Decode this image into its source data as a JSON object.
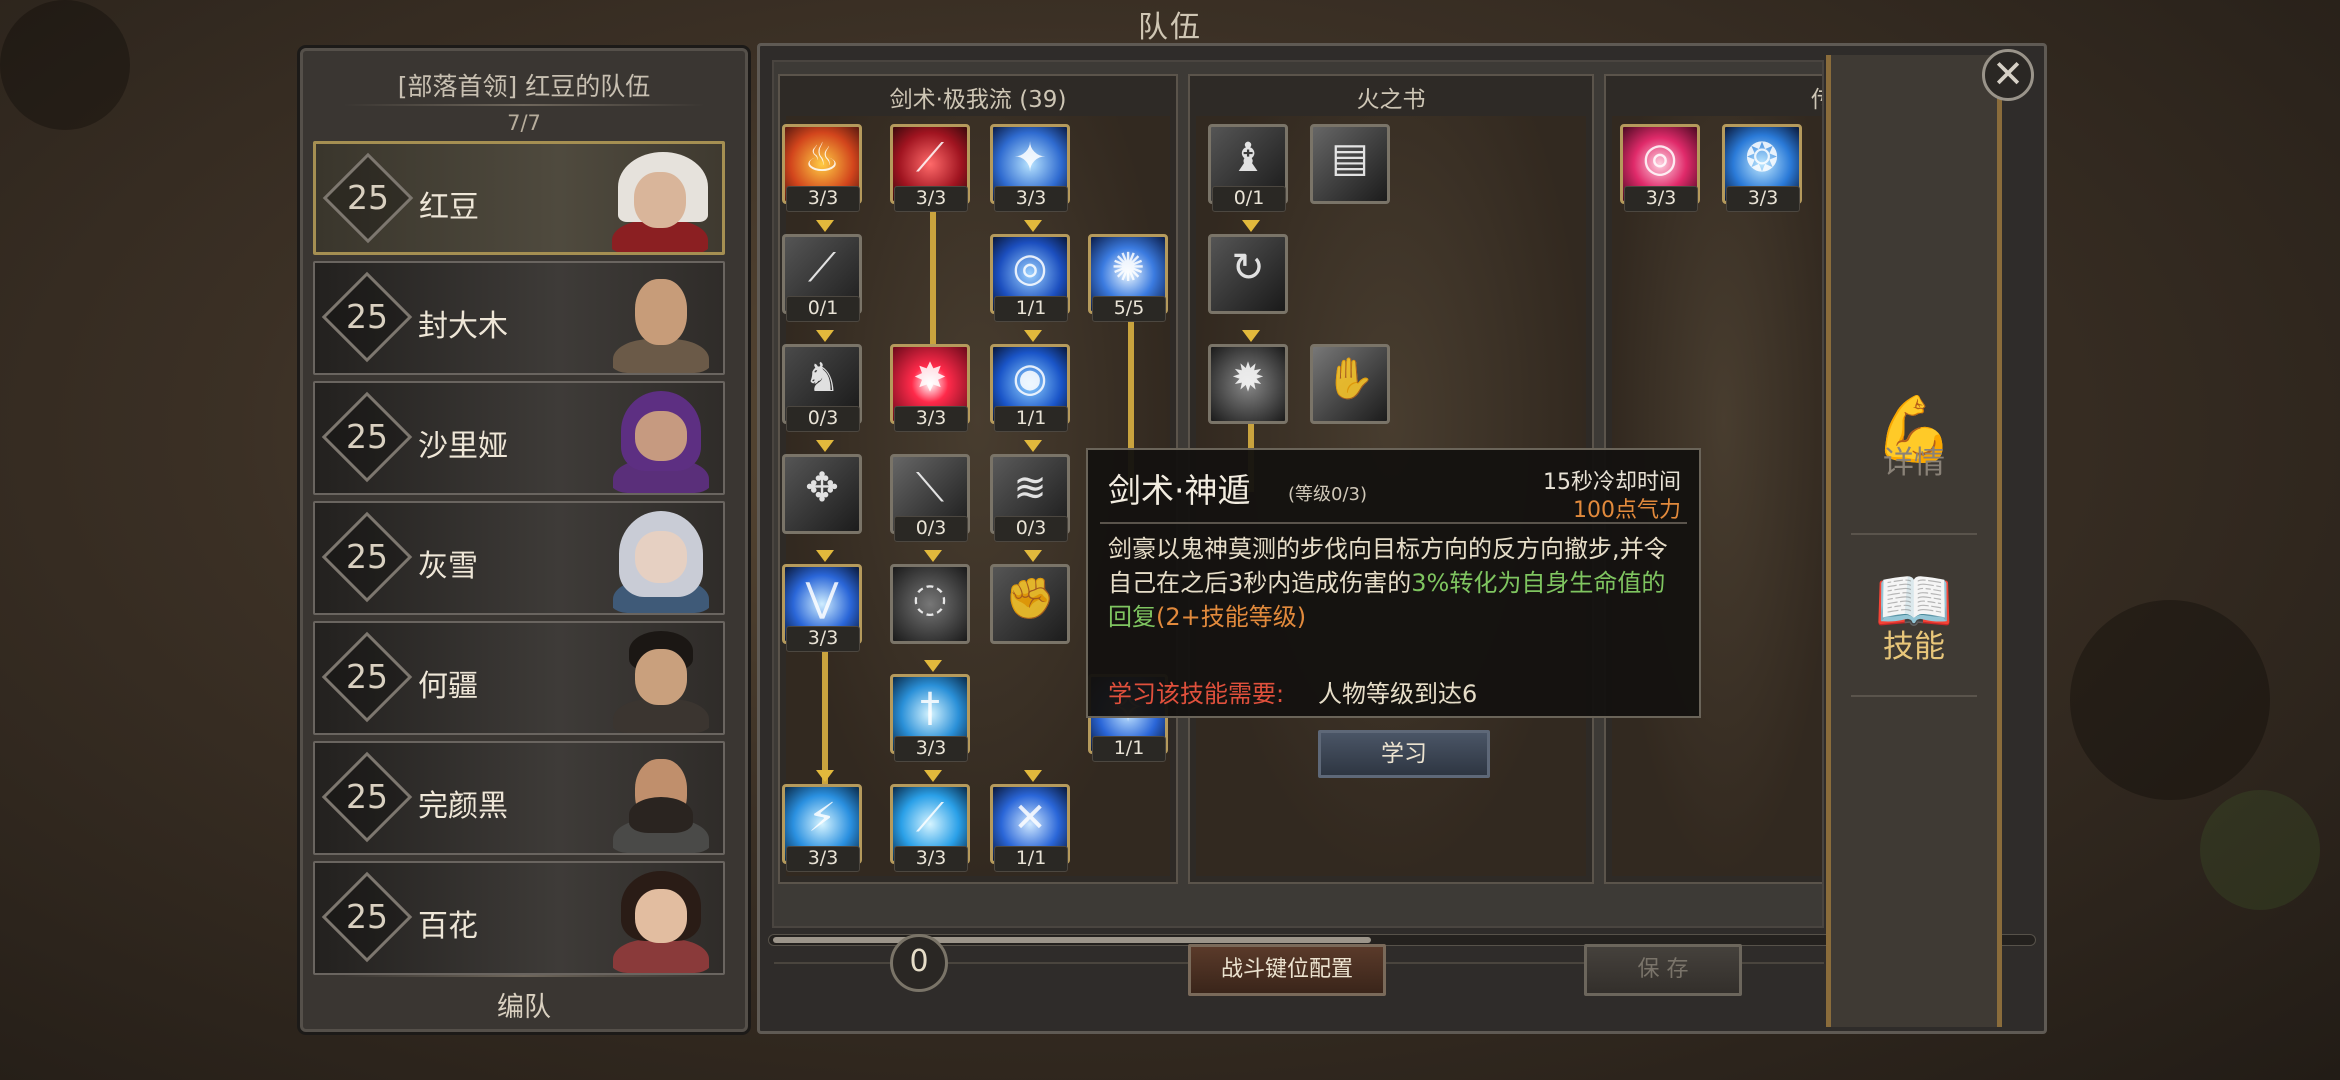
{
  "window_title": "队伍",
  "team": {
    "name": "[部落首领] 红豆的队伍",
    "count": "7/7",
    "members": [
      {
        "level": "25",
        "name": "红豆",
        "selected": true
      },
      {
        "level": "25",
        "name": "封大木",
        "selected": false
      },
      {
        "level": "25",
        "name": "沙里娅",
        "selected": false
      },
      {
        "level": "25",
        "name": "灰雪",
        "selected": false
      },
      {
        "level": "25",
        "name": "何疆",
        "selected": false
      },
      {
        "level": "25",
        "name": "完颜黑",
        "selected": false
      },
      {
        "level": "25",
        "name": "百花",
        "selected": false
      }
    ],
    "formation_label": "编队"
  },
  "skill_trees": {
    "col1_title": "剑术·极我流 (39)",
    "col2_title": "火之书",
    "col3_title": "传",
    "col1_nodes": [
      "3/3",
      "3/3",
      "3/3",
      "0/1",
      "1/1",
      "5/5",
      "0/3",
      "3/3",
      "1/1",
      "0/3",
      "0/3",
      "3/3",
      "3/3",
      "1/1",
      "3/3",
      "3/3",
      "1/1"
    ],
    "col2_nodes": [
      "0/1"
    ],
    "col3_nodes": [
      "3/3",
      "3/3"
    ]
  },
  "tooltip": {
    "skill_name": "剑术·神遁",
    "level": "(等级0/3)",
    "cooldown": "15秒冷却时间",
    "cost": "100点气力",
    "desc_plain": "剑豪以鬼神莫测的步伐向目标方向的反方向撤步,并令自己在之后3秒内造成伤害的",
    "desc_green": "3%转化为自身生命值的回复",
    "desc_orange": "(2+技能等级)",
    "req_label": "学习该技能需要:",
    "req_value": "人物等级到达6",
    "learn_button": "学习"
  },
  "bottom": {
    "points": "0",
    "keybind_button": "战斗键位配置",
    "save_button": "保 存"
  },
  "side_tabs": {
    "details": "详情",
    "skills": "技能"
  },
  "colors": {
    "gold": "#c9a33e",
    "green": "#7fc560",
    "orange": "#e28a3c",
    "red_label": "#e0503c"
  },
  "icons": {
    "close": "close-icon",
    "details": "strong-arm-icon",
    "skills": "skill-book-flame-icon"
  }
}
